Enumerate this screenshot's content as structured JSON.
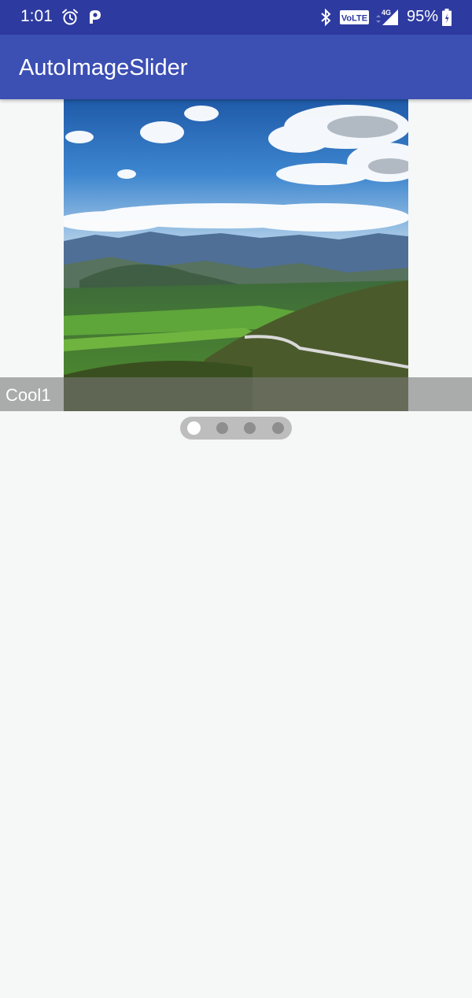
{
  "status_bar": {
    "time": "1:01",
    "icons": [
      "alarm-icon",
      "p-app-icon",
      "bluetooth-icon",
      "volte-icon",
      "4g-signal-icon",
      "battery-icon"
    ],
    "volte_label": "VoLTE",
    "network_label": "4G",
    "battery_percent": "95%"
  },
  "app_bar": {
    "title": "AutoImageSlider"
  },
  "slider": {
    "caption": "Cool1",
    "slide_count": 4,
    "active_index": 0
  },
  "colors": {
    "status_bar": "#2d3aa0",
    "app_bar": "#3c4fb3",
    "background": "#f6f7f7",
    "indicator_bg": "#bdbdbd",
    "indicator_dot": "#8e8e8e",
    "indicator_active": "#ffffff"
  }
}
